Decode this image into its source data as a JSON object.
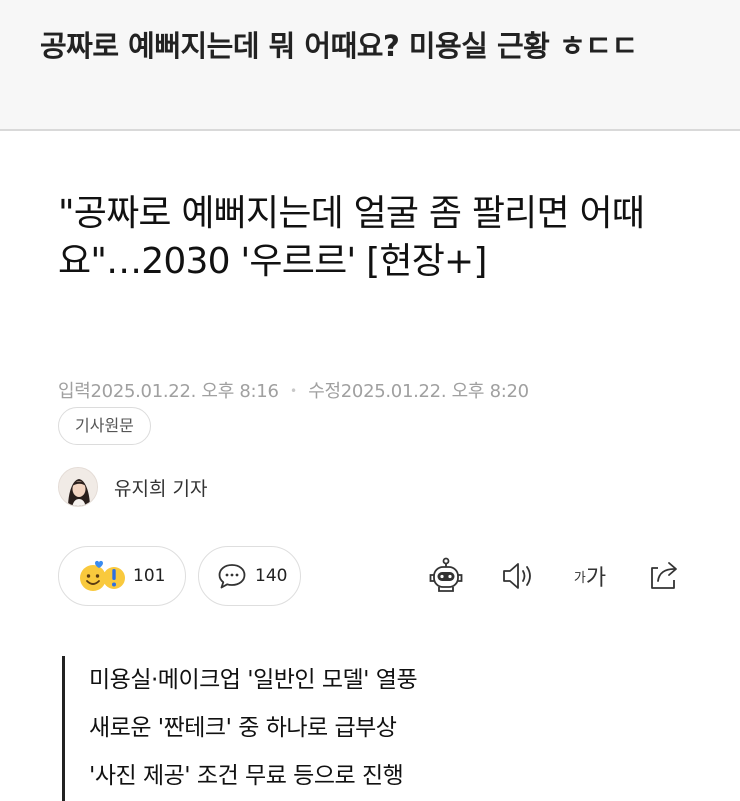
{
  "post": {
    "title": "공짜로 예뻐지는데 뭐 어때요? 미용실 근황 ㅎㄷㄷ"
  },
  "article": {
    "headline": "\"공짜로 예뻐지는데 얼굴 좀 팔리면 어때요\"…2030 '우르르' [현장+]",
    "meta": {
      "input_label": "입력",
      "input_time": "2025.01.22. 오후 8:16",
      "modified_label": "수정",
      "modified_time": "2025.01.22. 오후 8:20"
    },
    "original_button": "기사원문",
    "reporter": "유지희 기자",
    "reactions": {
      "react_count": "101",
      "comment_count": "140"
    },
    "tools": {
      "font_small": "가",
      "font_big": "가"
    },
    "summary": [
      "미용실·메이크업 '일반인 모델' 열풍",
      "새로운 '짠테크' 중 하나로 급부상",
      "'사진 제공' 조건 무료 등으로 진행"
    ]
  },
  "icons": {
    "reaction": "emoji-reaction-icon",
    "comment": "comment-icon",
    "bot": "ai-summary-bot-icon",
    "speaker": "speaker-icon",
    "font": "font-size-icon",
    "share": "share-icon"
  },
  "colors": {
    "header_bg": "#f7f7f7",
    "meta_text": "#a0a0a0",
    "emoji_yellow": "#f9c93d",
    "heart_blue": "#3b8cf0",
    "exclaim_blue": "#2f6fe0"
  }
}
